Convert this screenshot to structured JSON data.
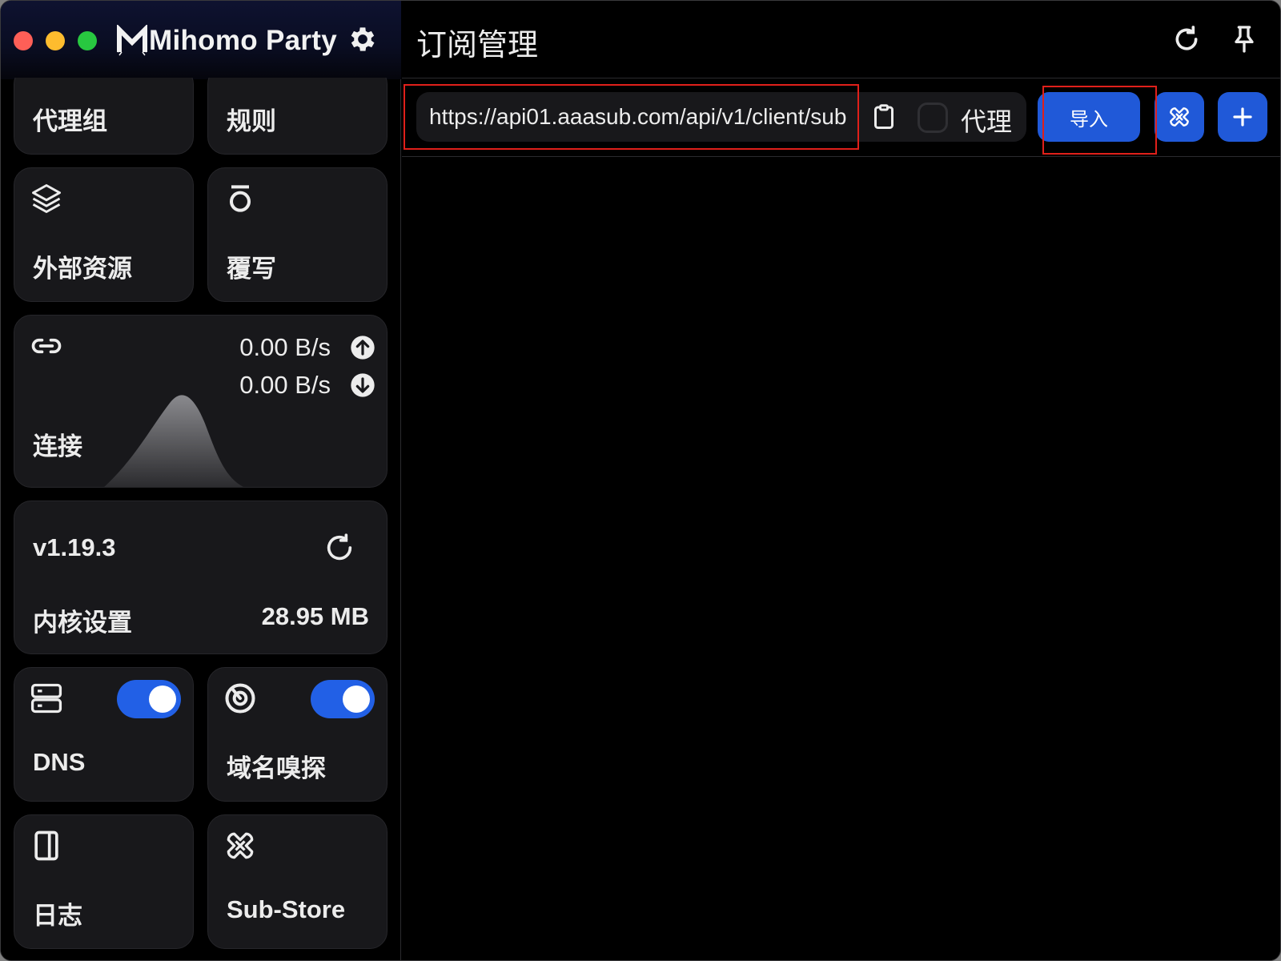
{
  "app": {
    "brand": "Mihomo Party"
  },
  "sidebar": {
    "cards": {
      "proxy_groups": {
        "label": "代理组"
      },
      "rules": {
        "label": "规则"
      },
      "external_resources": {
        "label": "外部资源",
        "icon": "layers-icon"
      },
      "override": {
        "label": "覆写",
        "icon": "override-icon"
      },
      "connections": {
        "label": "连接",
        "icon": "link-icon",
        "upload_speed": "0.00 B/s",
        "download_speed": "0.00 B/s"
      },
      "core": {
        "version": "v1.19.3",
        "label": "内核设置",
        "memory": "28.95 MB"
      },
      "dns": {
        "label": "DNS",
        "enabled": true,
        "icon": "server-icon"
      },
      "sniff": {
        "label": "域名嗅探",
        "enabled": true,
        "icon": "radar-icon"
      },
      "logs": {
        "label": "日志",
        "icon": "sidebar-panel-icon"
      },
      "substore": {
        "label": "Sub-Store",
        "icon": "substore-icon"
      }
    }
  },
  "main": {
    "title": "订阅管理",
    "url_input_value": "https://api01.aaasub.com/api/v1/client/sub",
    "proxy_checkbox_label": "代理",
    "proxy_checked": false,
    "import_label": "导入",
    "add_label": "+"
  },
  "colors": {
    "accent": "#2059d8",
    "card_bg": "#18181b",
    "highlight_box": "#e0201a"
  }
}
